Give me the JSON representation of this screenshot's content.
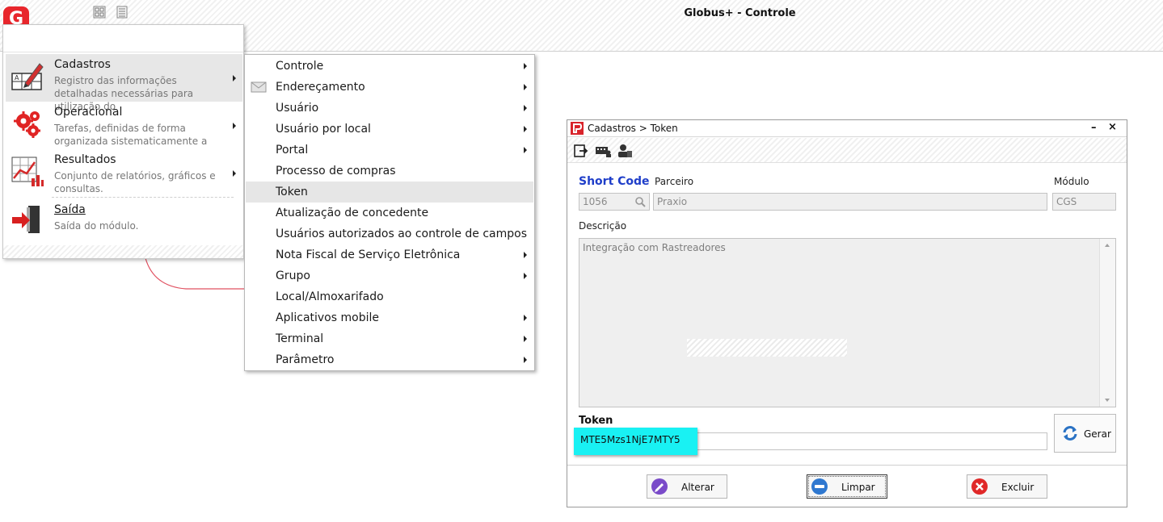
{
  "window": {
    "title": "Globus+ - Controle",
    "logo_letter": "G"
  },
  "main_menu": {
    "items": [
      {
        "title": "Cadastros",
        "desc": "Registro das informações detalhadas necessárias para utilização do",
        "icon": "form-edit-icon"
      },
      {
        "title": "Operacional",
        "desc": "Tarefas, definidas de forma organizada sistematicamente a",
        "icon": "gears-icon"
      },
      {
        "title": "Resultados",
        "desc": "Conjunto de relatórios, gráficos e consultas.",
        "icon": "chart-icon"
      },
      {
        "title": "Saída",
        "desc": "Saída do módulo.",
        "icon": "exit-door-icon"
      }
    ]
  },
  "submenu": {
    "items": [
      {
        "label": "Controle",
        "has_sub": true
      },
      {
        "label": "Endereçamento",
        "has_sub": true,
        "icon": "envelope-icon"
      },
      {
        "label": "Usuário",
        "has_sub": true
      },
      {
        "label": "Usuário por local",
        "has_sub": true
      },
      {
        "label": "Portal",
        "has_sub": true
      },
      {
        "label": "Processo de compras",
        "has_sub": false
      },
      {
        "label": "Token",
        "has_sub": false
      },
      {
        "label": "Atualização de concedente",
        "has_sub": false
      },
      {
        "label": "Usuários autorizados ao controle de campos",
        "has_sub": false
      },
      {
        "label": "Nota Fiscal de Serviço Eletrônica",
        "has_sub": true
      },
      {
        "label": "Grupo",
        "has_sub": true
      },
      {
        "label": "Local/Almoxarifado",
        "has_sub": false
      },
      {
        "label": "Aplicativos mobile",
        "has_sub": true
      },
      {
        "label": "Terminal",
        "has_sub": true
      },
      {
        "label": "Parâmetro",
        "has_sub": true
      }
    ]
  },
  "dialog": {
    "title": "Cadastros > Token",
    "minimize": "–",
    "close": "×",
    "labels": {
      "short_code": "Short Code",
      "parceiro": "Parceiro",
      "modulo": "Módulo",
      "descricao": "Descrição",
      "token": "Token"
    },
    "values": {
      "short_code": "1056",
      "parceiro": "Praxio",
      "modulo": "CGS",
      "descricao": "Integração com Rastreadores",
      "token": "MTE5Mzs1NjE7MTY5"
    },
    "buttons": {
      "gerar": "Gerar",
      "alterar": "Alterar",
      "limpar": "Limpar",
      "excluir": "Excluir"
    }
  },
  "colors": {
    "brand": "#e8262c",
    "label_blue": "#1f3ec9",
    "token_highlight": "#19f1f3"
  }
}
